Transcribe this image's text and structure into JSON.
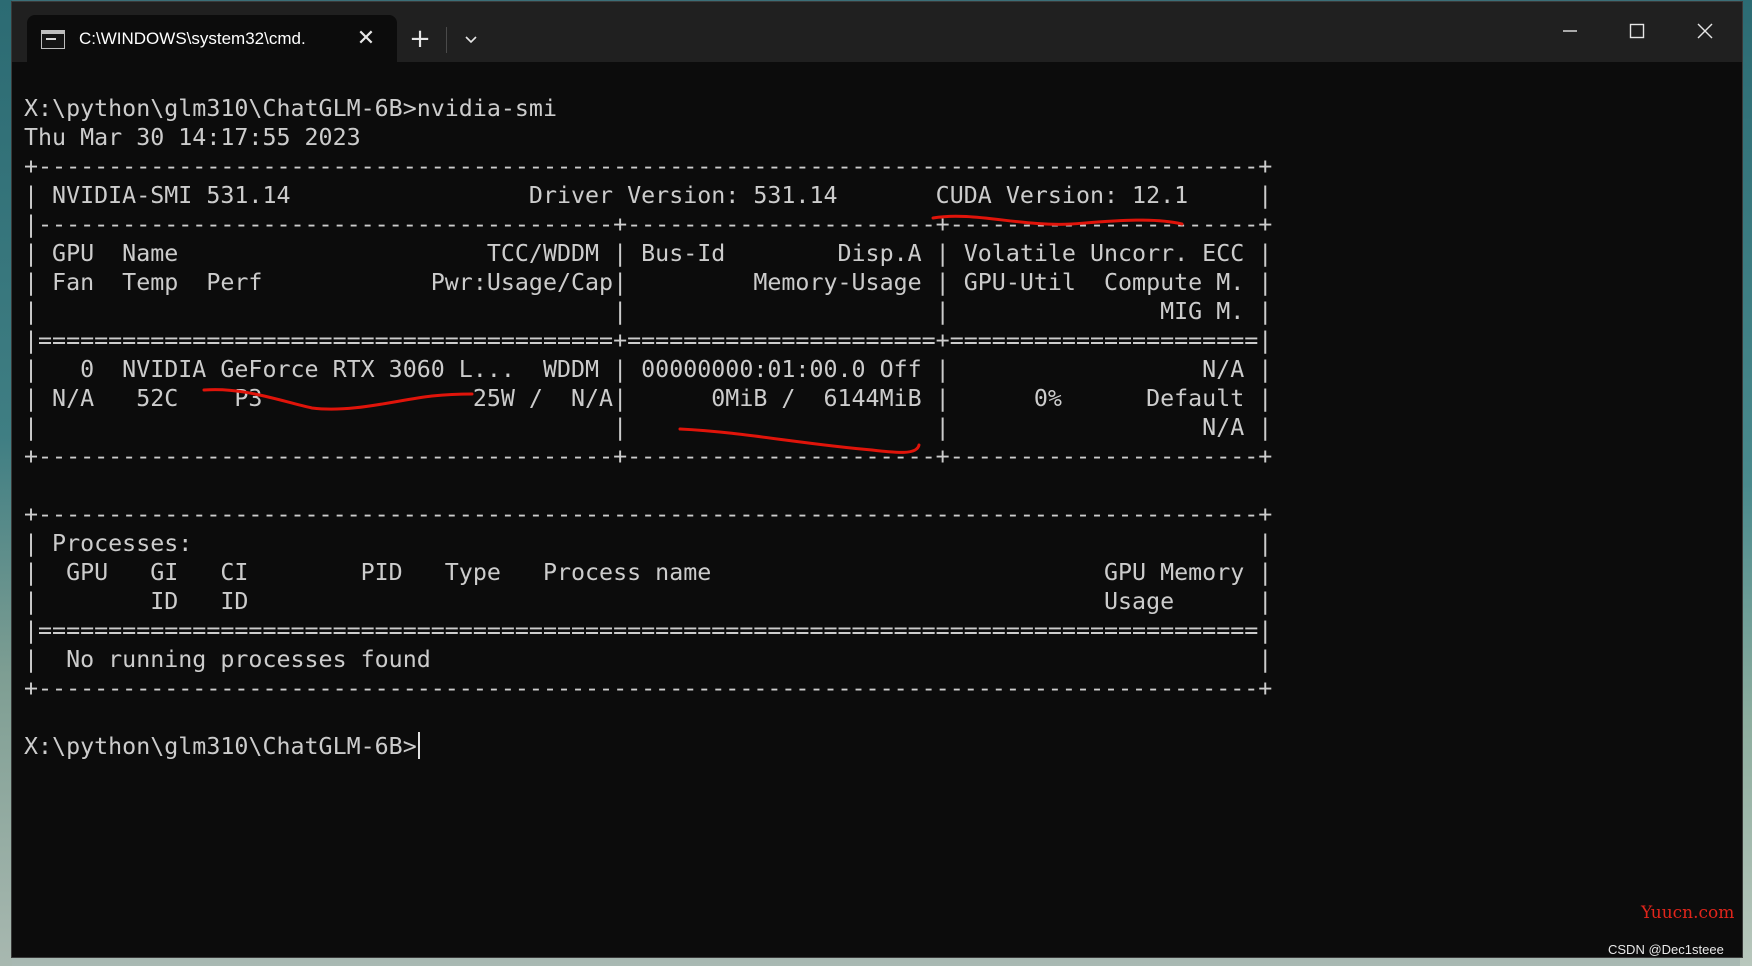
{
  "window": {
    "tab_title": "C:\\WINDOWS\\system32\\cmd.",
    "tab_close_glyph": "✕",
    "new_tab_glyph": "+",
    "dropdown_icon": "chevron-down-icon",
    "minimize_icon": "minimize-icon",
    "maximize_icon": "maximize-icon",
    "close_icon": "close-icon",
    "terminal_icon": "cmd-icon"
  },
  "terminal": {
    "lines": [
      "X:\\python\\glm310\\ChatGLM-6B>nvidia-smi",
      "Thu Mar 30 14:17:55 2023",
      "+---------------------------------------------------------------------------------------+",
      "| NVIDIA-SMI 531.14                 Driver Version: 531.14       CUDA Version: 12.1     |",
      "|-----------------------------------------+----------------------+----------------------+",
      "| GPU  Name                      TCC/WDDM | Bus-Id        Disp.A | Volatile Uncorr. ECC |",
      "| Fan  Temp  Perf            Pwr:Usage/Cap|         Memory-Usage | GPU-Util  Compute M. |",
      "|                                         |                      |               MIG M. |",
      "|=========================================+======================+======================|",
      "|   0  NVIDIA GeForce RTX 3060 L...  WDDM | 00000000:01:00.0 Off |                  N/A |",
      "| N/A   52C    P3               25W /  N/A|      0MiB /  6144MiB |      0%      Default |",
      "|                                         |                      |                  N/A |",
      "+-----------------------------------------+----------------------+----------------------+",
      "",
      "+---------------------------------------------------------------------------------------+",
      "| Processes:                                                                            |",
      "|  GPU   GI   CI        PID   Type   Process name                            GPU Memory |",
      "|        ID   ID                                                             Usage      |",
      "|=======================================================================================|",
      "|  No running processes found                                                           |",
      "+---------------------------------------------------------------------------------------+",
      "",
      "X:\\python\\glm310\\ChatGLM-6B>"
    ],
    "text_color": "#cccccc",
    "background": "#0c0c0c"
  },
  "annotation_color": "#e0140a",
  "watermarks": {
    "site": "Yuucn.com",
    "author": "CSDN @Dec1steee"
  }
}
